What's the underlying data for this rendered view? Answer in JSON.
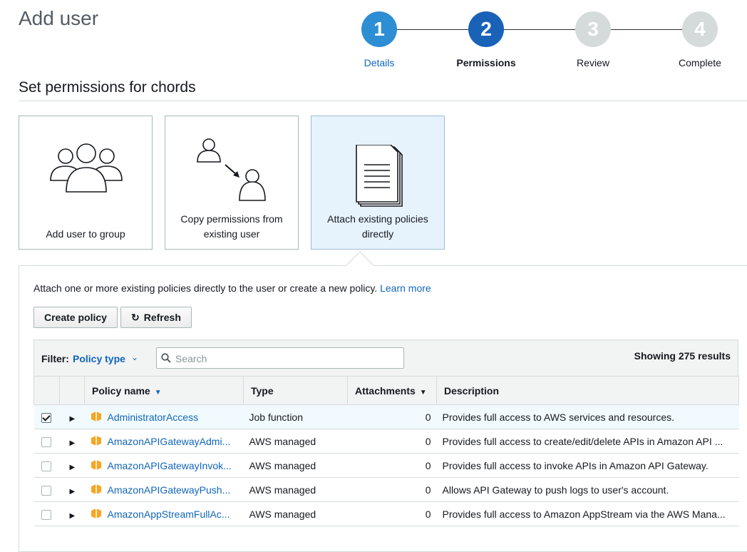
{
  "page": {
    "title": "Add user",
    "section_title": "Set permissions for chords"
  },
  "wizard": {
    "steps": [
      {
        "number": "1",
        "label": "Details",
        "state": "done"
      },
      {
        "number": "2",
        "label": "Permissions",
        "state": "active"
      },
      {
        "number": "3",
        "label": "Review",
        "state": "todo"
      },
      {
        "number": "4",
        "label": "Complete",
        "state": "todo"
      }
    ]
  },
  "options": [
    {
      "label": "Add user to group",
      "icon": "group-users-icon",
      "selected": false
    },
    {
      "label": "Copy permissions from existing user",
      "icon": "copy-user-icon",
      "selected": false
    },
    {
      "label": "Attach existing policies directly",
      "icon": "document-stack-icon",
      "selected": true
    }
  ],
  "description": {
    "text": "Attach one or more existing policies directly to the user or create a new policy.",
    "link": "Learn more"
  },
  "toolbar": {
    "create_label": "Create policy",
    "refresh_label": "Refresh",
    "refresh_icon": "refresh-icon"
  },
  "filter": {
    "label": "Filter:",
    "value": "Policy type",
    "search_placeholder": "Search",
    "search_value": "",
    "results": "Showing 275 results"
  },
  "table": {
    "columns": [
      "",
      "",
      "Policy name",
      "Type",
      "Attachments",
      "Description"
    ],
    "rows": [
      {
        "checked": true,
        "name": "AdministratorAccess",
        "type": "Job function",
        "attachments": "0",
        "description": "Provides full access to AWS services and resources."
      },
      {
        "checked": false,
        "name": "AmazonAPIGatewayAdmi...",
        "type": "AWS managed",
        "attachments": "0",
        "description": "Provides full access to create/edit/delete APIs in Amazon API ..."
      },
      {
        "checked": false,
        "name": "AmazonAPIGatewayInvok...",
        "type": "AWS managed",
        "attachments": "0",
        "description": "Provides full access to invoke APIs in Amazon API Gateway."
      },
      {
        "checked": false,
        "name": "AmazonAPIGatewayPush...",
        "type": "AWS managed",
        "attachments": "0",
        "description": "Allows API Gateway to push logs to user's account."
      },
      {
        "checked": false,
        "name": "AmazonAppStreamFullAc...",
        "type": "AWS managed",
        "attachments": "0",
        "description": "Provides full access to Amazon AppStream via the AWS Mana..."
      }
    ]
  },
  "colors": {
    "link": "#1166bb",
    "step_active": "#1a62b8",
    "step_done": "#2e8ed4",
    "step_todo": "#d5dbdb",
    "package": "#f5a623",
    "selected_card": "#e6f2fc"
  }
}
